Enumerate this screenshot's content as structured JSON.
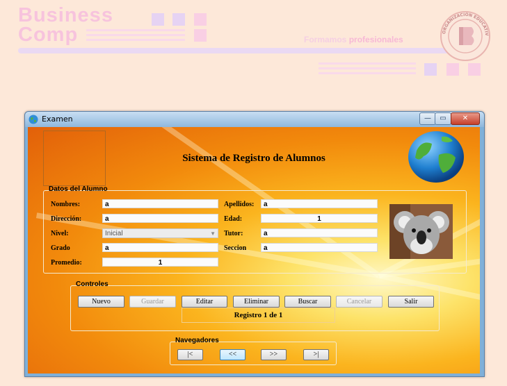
{
  "brand": {
    "line1": "Business",
    "line2": "Comp",
    "tagline_part1": "Formamos",
    "tagline_part2": "profesionales",
    "seal_text": "ORGANIZACIÓN EDUCATIVA BUSINESS COMP"
  },
  "window": {
    "title": "Examen",
    "app_title": "Sistema de Registro de Alumnos",
    "min_glyph": "—",
    "max_glyph": "▭",
    "close_glyph": "✕"
  },
  "datos": {
    "group_label": "Datos del Alumno",
    "nombres_label": "Nombres:",
    "nombres_value": "a",
    "direccion_label": "Dirección:",
    "direccion_value": "a",
    "nivel_label": "Nivel:",
    "nivel_selected": "Inicial",
    "grado_label": "Grado",
    "grado_value": "a",
    "promedio_label": "Promedio:",
    "promedio_value": "1",
    "apellidos_label": "Apellidos:",
    "apellidos_value": "a",
    "edad_label": "Edad:",
    "edad_value": "1",
    "tutor_label": "Tutor:",
    "tutor_value": "a",
    "seccion_label": "Seccion",
    "seccion_value": "a"
  },
  "controles": {
    "group_label": "Controles",
    "nuevo": "Nuevo",
    "guardar": "Guardar",
    "editar": "Editar",
    "eliminar": "Eliminar",
    "buscar": "Buscar",
    "cancelar": "Cancelar",
    "salir": "Salir",
    "registro": "Registro 1 de 1"
  },
  "navegadores": {
    "group_label": "Navegadores",
    "first": "|<",
    "prev": "<<",
    "next": ">>",
    "last": ">|"
  },
  "colors": {
    "brand_pink": "#f7c3dd",
    "brand_lavender": "#e6d3f3",
    "page_bg": "#fde8d9",
    "accent_orange": "#f28a0c"
  }
}
